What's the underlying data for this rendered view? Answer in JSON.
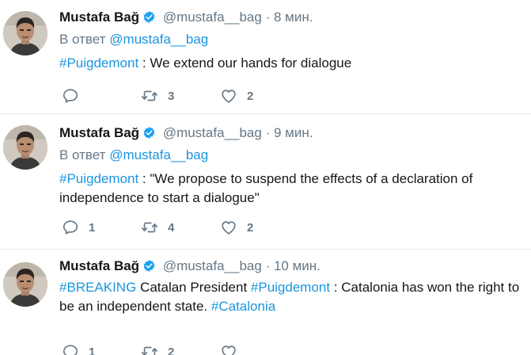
{
  "tweets": [
    {
      "name": "Mustafa Bağ",
      "handle": "@mustafa__bag",
      "separator": "·",
      "time": "8 мин.",
      "reply_prefix": "В ответ",
      "reply_to": "@mustafa__bag",
      "text_parts": [
        "#Puigdemont",
        " : We extend our hands for dialogue"
      ],
      "reply_count": "",
      "retweet_count": "3",
      "like_count": "2"
    },
    {
      "name": "Mustafa Bağ",
      "handle": "@mustafa__bag",
      "separator": "·",
      "time": "9 мин.",
      "reply_prefix": "В ответ",
      "reply_to": "@mustafa__bag",
      "text_parts": [
        "#Puigdemont",
        " : \"We propose to suspend the effects of a declaration of independence to start a dialogue\""
      ],
      "reply_count": "1",
      "retweet_count": "4",
      "like_count": "2"
    },
    {
      "name": "Mustafa Bağ",
      "handle": "@mustafa__bag",
      "separator": "·",
      "time": "10 мин.",
      "text_parts": [
        "#BREAKING",
        " Catalan President ",
        "#Puigdemont",
        " : Catalonia has won the right to be an independent state. ",
        "#Catalonia"
      ],
      "reply_count": "1",
      "retweet_count": "2",
      "like_count": ""
    }
  ],
  "icons": {
    "verified": "verified-badge-icon",
    "reply": "reply-icon",
    "retweet": "retweet-icon",
    "like": "heart-icon"
  },
  "colors": {
    "accent": "#1b95e0",
    "muted": "#657786",
    "text": "#14171a",
    "verified": "#1da1f2",
    "divider": "#e6ecf0"
  }
}
